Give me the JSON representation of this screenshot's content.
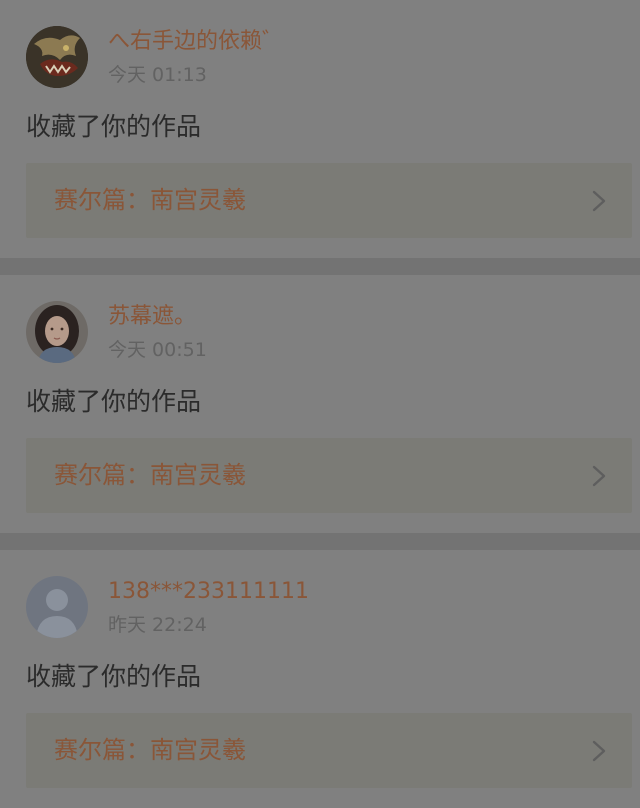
{
  "colors": {
    "background": "#7d7d7d",
    "card": "#808080",
    "divider": "#737373",
    "accent_text": "#8a5638",
    "secondary_text": "#626262",
    "primary_text": "#2b2b2b",
    "work_box": "#7b7b76"
  },
  "notifications": [
    {
      "username": "へ右手边的依赖゛",
      "timestamp": "今天 01:13",
      "activity": "收藏了你的作品",
      "work_title": "赛尔篇：南宫灵羲",
      "avatar": "dragon-avatar",
      "chevron": "chevron-right-icon"
    },
    {
      "username": "苏幕遮。",
      "timestamp": "今天 00:51",
      "activity": "收藏了你的作品",
      "work_title": "赛尔篇：南宫灵羲",
      "avatar": "girl-portrait-avatar",
      "chevron": "chevron-right-icon"
    },
    {
      "username": "138***233111111",
      "timestamp": "昨天 22:24",
      "activity": "收藏了你的作品",
      "work_title": "赛尔篇：南宫灵羲",
      "avatar": "default-user-avatar",
      "chevron": "chevron-right-icon"
    }
  ]
}
